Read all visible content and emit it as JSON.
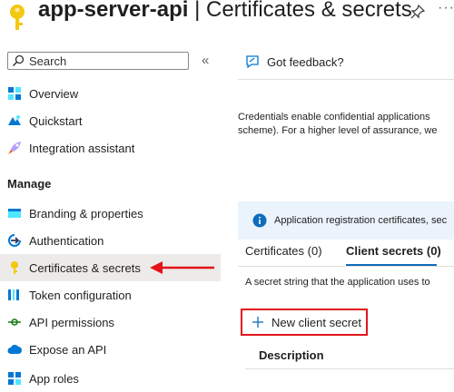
{
  "header": {
    "app_name": "app-server-api",
    "separator": " | ",
    "page_name": "Certificates & secrets",
    "more_label": "···"
  },
  "sidebar": {
    "search_placeholder": "Search",
    "collapse_label": "«",
    "items_top": [
      {
        "label": "Overview",
        "icon": "overview-icon"
      },
      {
        "label": "Quickstart",
        "icon": "quickstart-icon"
      },
      {
        "label": "Integration assistant",
        "icon": "rocket-icon"
      }
    ],
    "manage_heading": "Manage",
    "items_manage": [
      {
        "label": "Branding & properties",
        "icon": "branding-icon"
      },
      {
        "label": "Authentication",
        "icon": "authentication-icon"
      },
      {
        "label": "Certificates & secrets",
        "icon": "key-icon",
        "selected": true
      },
      {
        "label": "Token configuration",
        "icon": "token-icon"
      },
      {
        "label": "API permissions",
        "icon": "api-permissions-icon"
      },
      {
        "label": "Expose an API",
        "icon": "cloud-icon"
      },
      {
        "label": "App roles",
        "icon": "app-roles-icon"
      }
    ]
  },
  "main": {
    "feedback_label": "Got feedback?",
    "description_line1": "Credentials enable confidential applications",
    "description_line2": "scheme). For a higher level of assurance, we",
    "info_banner": "Application registration certificates, sec",
    "tabs": [
      {
        "label": "Certificates (0)",
        "active": false
      },
      {
        "label": "Client secrets (0)",
        "active": true
      }
    ],
    "secret_description": "A secret string that the application uses to",
    "new_secret_label": "New client secret",
    "column_description": "Description"
  },
  "colors": {
    "accent": "#0f6cbd",
    "highlight_red": "#e3141a",
    "selected_bg": "#edebe9",
    "banner_bg": "#ebf3fc",
    "key_yellow": "#f2c811"
  }
}
